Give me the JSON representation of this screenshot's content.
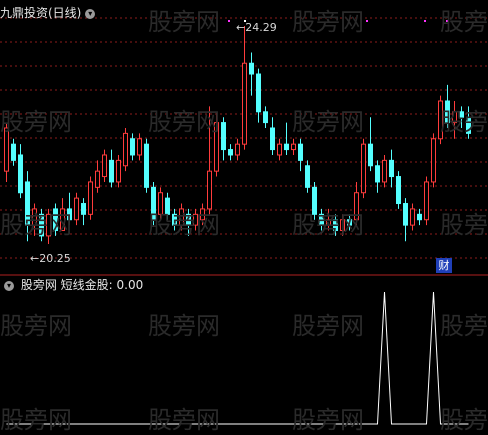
{
  "top_panel": {
    "title": "九鼎投资(日线)",
    "collapse_icon": "chevron-down-icon"
  },
  "bottom_panel": {
    "indicator_name": "股旁网",
    "label": "短线金股: 0.00",
    "collapse_icon": "chevron-down-icon"
  },
  "watermark": "股旁网",
  "badge": "财",
  "annotations": {
    "high": "24.29",
    "low": "20.25"
  },
  "colors": {
    "up": "#ff3c3c",
    "down": "#54ffff",
    "grid": "#8c1c1c",
    "separator": "#b02020",
    "signal": "#ffffff"
  },
  "chart_data": [
    {
      "type": "candlestick",
      "title": "九鼎投资(日线)",
      "high_label": 24.29,
      "low_label": 20.25,
      "candles": [
        {
          "o": 21.6,
          "c": 22.4,
          "h": 22.5,
          "l": 21.4
        },
        {
          "o": 22.1,
          "c": 21.8,
          "h": 22.2,
          "l": 21.7
        },
        {
          "o": 21.9,
          "c": 21.2,
          "h": 22.1,
          "l": 21.1
        },
        {
          "o": 21.4,
          "c": 20.6,
          "h": 21.6,
          "l": 20.3
        },
        {
          "o": 20.6,
          "c": 20.9,
          "h": 21.0,
          "l": 20.4
        },
        {
          "o": 20.8,
          "c": 20.4,
          "h": 20.9,
          "l": 20.3
        },
        {
          "o": 20.4,
          "c": 20.8,
          "h": 20.9,
          "l": 20.25
        },
        {
          "o": 20.9,
          "c": 20.5,
          "h": 21.0,
          "l": 20.4
        },
        {
          "o": 20.5,
          "c": 20.9,
          "h": 21.1,
          "l": 20.5
        },
        {
          "o": 20.9,
          "c": 20.7,
          "h": 21.2,
          "l": 20.6
        },
        {
          "o": 20.7,
          "c": 21.1,
          "h": 21.2,
          "l": 20.6
        },
        {
          "o": 21.0,
          "c": 20.8,
          "h": 21.1,
          "l": 20.6
        },
        {
          "o": 20.8,
          "c": 21.4,
          "h": 21.5,
          "l": 20.7
        },
        {
          "o": 21.3,
          "c": 21.6,
          "h": 21.8,
          "l": 21.2
        },
        {
          "o": 21.5,
          "c": 21.9,
          "h": 22.0,
          "l": 21.4
        },
        {
          "o": 21.8,
          "c": 21.4,
          "h": 22.0,
          "l": 21.3
        },
        {
          "o": 21.4,
          "c": 21.8,
          "h": 21.9,
          "l": 21.3
        },
        {
          "o": 21.7,
          "c": 22.3,
          "h": 22.4,
          "l": 21.6
        },
        {
          "o": 22.2,
          "c": 21.9,
          "h": 22.3,
          "l": 21.8
        },
        {
          "o": 21.9,
          "c": 22.2,
          "h": 22.3,
          "l": 21.8
        },
        {
          "o": 22.1,
          "c": 21.3,
          "h": 22.2,
          "l": 21.2
        },
        {
          "o": 21.3,
          "c": 20.7,
          "h": 21.4,
          "l": 20.6
        },
        {
          "o": 20.8,
          "c": 21.2,
          "h": 21.3,
          "l": 20.7
        },
        {
          "o": 21.1,
          "c": 20.8,
          "h": 21.2,
          "l": 20.7
        },
        {
          "o": 20.8,
          "c": 20.6,
          "h": 20.9,
          "l": 20.5
        },
        {
          "o": 20.6,
          "c": 20.9,
          "h": 21.0,
          "l": 20.5
        },
        {
          "o": 20.8,
          "c": 20.6,
          "h": 20.9,
          "l": 20.4
        },
        {
          "o": 20.6,
          "c": 20.8,
          "h": 20.9,
          "l": 20.5
        },
        {
          "o": 20.7,
          "c": 20.9,
          "h": 21.0,
          "l": 20.6
        },
        {
          "o": 20.9,
          "c": 21.6,
          "h": 22.8,
          "l": 20.8
        },
        {
          "o": 21.6,
          "c": 22.5,
          "h": 22.7,
          "l": 21.5
        },
        {
          "o": 22.5,
          "c": 22.0,
          "h": 22.6,
          "l": 21.8
        },
        {
          "o": 22.0,
          "c": 21.9,
          "h": 22.1,
          "l": 21.8
        },
        {
          "o": 21.9,
          "c": 22.1,
          "h": 22.2,
          "l": 21.8
        },
        {
          "o": 22.1,
          "c": 23.6,
          "h": 24.29,
          "l": 22.0
        },
        {
          "o": 23.6,
          "c": 23.4,
          "h": 23.8,
          "l": 23.0
        },
        {
          "o": 23.4,
          "c": 22.7,
          "h": 23.5,
          "l": 22.5
        },
        {
          "o": 22.7,
          "c": 22.5,
          "h": 22.8,
          "l": 22.4
        },
        {
          "o": 22.4,
          "c": 22.0,
          "h": 22.6,
          "l": 21.9
        },
        {
          "o": 21.9,
          "c": 22.1,
          "h": 22.2,
          "l": 21.8
        },
        {
          "o": 22.1,
          "c": 22.0,
          "h": 22.5,
          "l": 21.9
        },
        {
          "o": 22.0,
          "c": 22.1,
          "h": 22.2,
          "l": 21.9
        },
        {
          "o": 22.1,
          "c": 21.8,
          "h": 22.2,
          "l": 21.6
        },
        {
          "o": 21.7,
          "c": 21.3,
          "h": 21.8,
          "l": 21.2
        },
        {
          "o": 21.3,
          "c": 20.8,
          "h": 21.4,
          "l": 20.7
        },
        {
          "o": 20.8,
          "c": 20.6,
          "h": 20.9,
          "l": 20.5
        },
        {
          "o": 20.6,
          "c": 20.7,
          "h": 20.9,
          "l": 20.5
        },
        {
          "o": 20.7,
          "c": 20.5,
          "h": 20.8,
          "l": 20.4
        },
        {
          "o": 20.5,
          "c": 20.7,
          "h": 20.8,
          "l": 20.4
        },
        {
          "o": 20.7,
          "c": 20.6,
          "h": 20.8,
          "l": 20.5
        },
        {
          "o": 20.7,
          "c": 21.2,
          "h": 21.4,
          "l": 20.6
        },
        {
          "o": 21.2,
          "c": 22.1,
          "h": 22.2,
          "l": 21.1
        },
        {
          "o": 22.1,
          "c": 21.7,
          "h": 22.6,
          "l": 21.6
        },
        {
          "o": 21.7,
          "c": 21.4,
          "h": 21.8,
          "l": 21.2
        },
        {
          "o": 21.4,
          "c": 21.8,
          "h": 21.9,
          "l": 21.3
        },
        {
          "o": 21.8,
          "c": 21.5,
          "h": 22.0,
          "l": 21.3
        },
        {
          "o": 21.5,
          "c": 21.0,
          "h": 21.6,
          "l": 20.9
        },
        {
          "o": 21.0,
          "c": 20.6,
          "h": 21.1,
          "l": 20.3
        },
        {
          "o": 20.6,
          "c": 20.9,
          "h": 21.0,
          "l": 20.5
        },
        {
          "o": 20.8,
          "c": 20.7,
          "h": 20.9,
          "l": 20.6
        },
        {
          "o": 20.7,
          "c": 21.4,
          "h": 21.5,
          "l": 20.6
        },
        {
          "o": 21.4,
          "c": 22.2,
          "h": 22.3,
          "l": 21.3
        },
        {
          "o": 22.2,
          "c": 22.9,
          "h": 23.0,
          "l": 22.1
        },
        {
          "o": 22.9,
          "c": 22.5,
          "h": 23.2,
          "l": 22.4
        },
        {
          "o": 22.5,
          "c": 22.7,
          "h": 22.9,
          "l": 22.2
        },
        {
          "o": 22.7,
          "c": 22.6,
          "h": 22.8,
          "l": 22.4
        },
        {
          "o": 22.6,
          "c": 22.3,
          "h": 22.8,
          "l": 22.2
        }
      ]
    },
    {
      "type": "line",
      "title": "短线金股",
      "current_value": 0.0,
      "values": [
        0,
        0,
        0,
        0,
        0,
        0,
        0,
        0,
        0,
        0,
        0,
        0,
        0,
        0,
        0,
        0,
        0,
        0,
        0,
        0,
        0,
        0,
        0,
        0,
        0,
        0,
        0,
        0,
        0,
        0,
        0,
        0,
        0,
        0,
        0,
        0,
        0,
        0,
        0,
        0,
        0,
        0,
        0,
        0,
        0,
        0,
        0,
        0,
        0,
        0,
        0,
        0,
        0,
        0,
        1,
        0,
        0,
        0,
        0,
        0,
        0,
        1,
        0,
        0,
        0,
        0,
        0
      ]
    }
  ]
}
